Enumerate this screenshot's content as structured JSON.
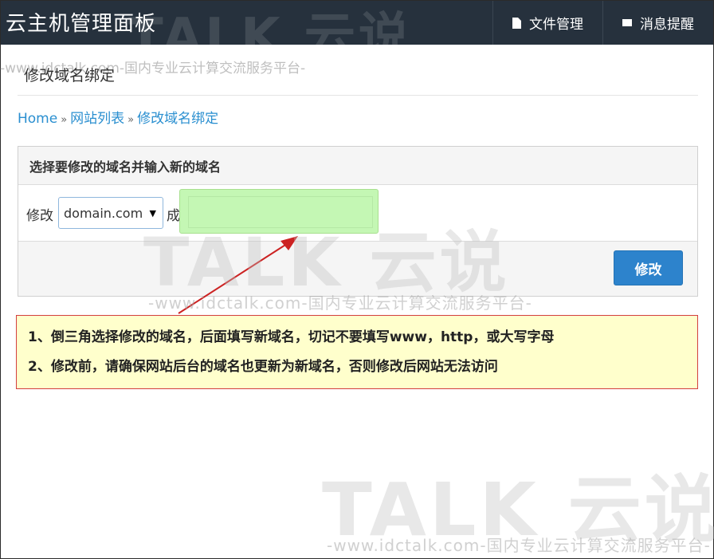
{
  "header": {
    "app_title": "云主机管理面板",
    "nav": [
      {
        "label": "文件管理",
        "icon": "file-icon"
      },
      {
        "label": "消息提醒",
        "icon": "mail-icon"
      }
    ]
  },
  "page": {
    "heading": "修改域名绑定",
    "breadcrumb": [
      {
        "label": "Home"
      },
      {
        "label": "网站列表"
      },
      {
        "label": "修改域名绑定"
      }
    ],
    "breadcrumb_separator": "»"
  },
  "form": {
    "panel_title": "选择要修改的域名并输入新的域名",
    "modify_label": "修改",
    "domain_select": {
      "selected": "domain.com",
      "caret": "▼"
    },
    "to_label": "成",
    "new_domain_value": "",
    "submit_label": "修改"
  },
  "notice": {
    "lines": [
      "1、倒三角选择修改的域名，后面填写新域名，切记不要填写www，http，或大写字母",
      "2、修改前，请确保网站后台的域名也更新为新域名，否则修改后网站无法访问"
    ]
  },
  "watermark": {
    "logo": "TALK 云说",
    "url": "-www.idctalk.com-国内专业云计算交流服务平台-"
  },
  "colors": {
    "topbar": "#26313d",
    "link": "#2a8fd0",
    "button": "#2d83cc",
    "input_highlight": "#c4f7b4",
    "notice_bg": "#ffffcc",
    "notice_border": "#d33f3f",
    "arrow": "#cc2222"
  }
}
